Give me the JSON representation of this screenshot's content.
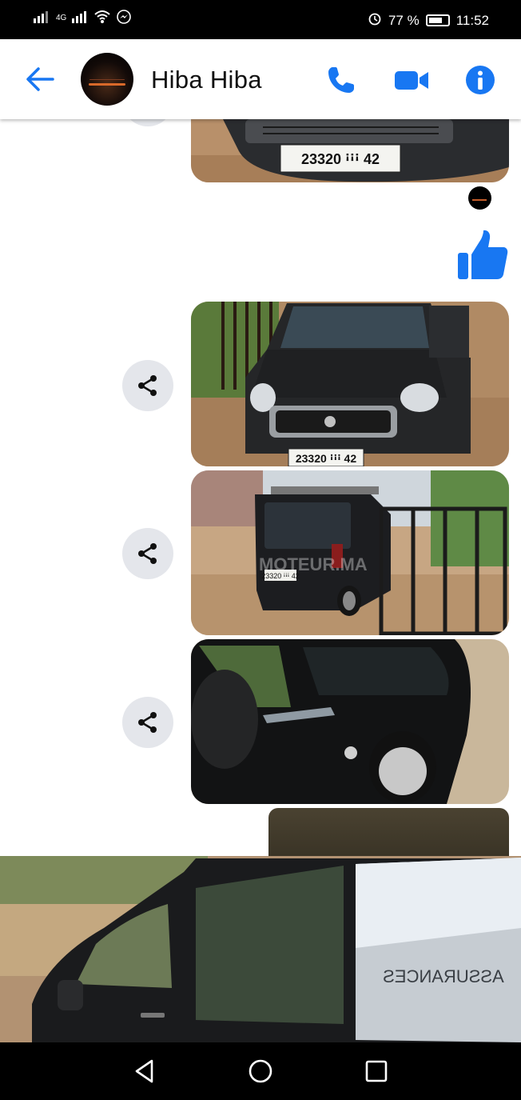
{
  "status_bar": {
    "network": "4G",
    "battery": "77 %",
    "time": "11:52"
  },
  "header": {
    "contact_name": "Hiba Hiba"
  },
  "messages": [
    {
      "type": "photo",
      "description_icon": "car-front-plate-photo",
      "plate_text": "23320 ꜟꜟꜟ 42"
    },
    {
      "type": "thumbs-up"
    },
    {
      "type": "photo",
      "description_icon": "car-front-photo",
      "plate_text": "23320 ꜟꜟꜟ 42"
    },
    {
      "type": "photo",
      "description_icon": "car-rear-photo",
      "watermark": "MOTEUR.MA"
    },
    {
      "type": "photo",
      "description_icon": "car-side-mirror-photo"
    },
    {
      "type": "photo",
      "description_icon": "car-side-photo",
      "reflection_text": "ASSURANCES"
    }
  ],
  "colors": {
    "accent": "#1877f2",
    "status_bar": "#000000",
    "share_button_bg": "#e4e6eb"
  }
}
